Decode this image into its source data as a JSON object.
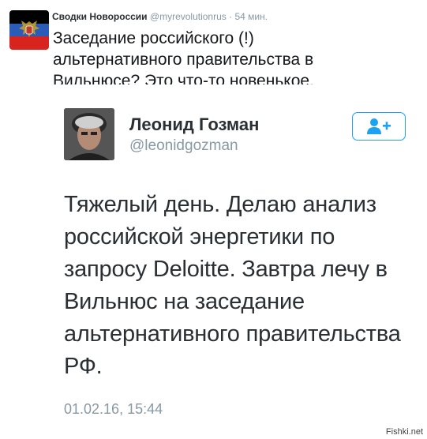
{
  "tweet": {
    "author_name": "Сводки Новороссии",
    "handle": "@myrevolutionrus",
    "separator": "·",
    "time_ago": "54 мин.",
    "text": "Заседание российского (!) альтернативного правительства в Вильнюсе? Это что-то новенькое."
  },
  "quoted": {
    "name": "Леонид Гозман",
    "handle": "@leonidgozman",
    "text": "Тяжелый день. Делаю анализ российской энергетики по запросу Deloitte. Завтра лечу в Вильнюс на заседание альтернативного правительства РФ.",
    "date": "01.02.16, 15:44",
    "follow_icon": "add-user-icon"
  },
  "watermark": "Fishki.net",
  "colors": {
    "accent": "#1da1f2",
    "flag_black": "#000000",
    "flag_blue": "#2b5db8",
    "flag_red": "#d9231f"
  }
}
